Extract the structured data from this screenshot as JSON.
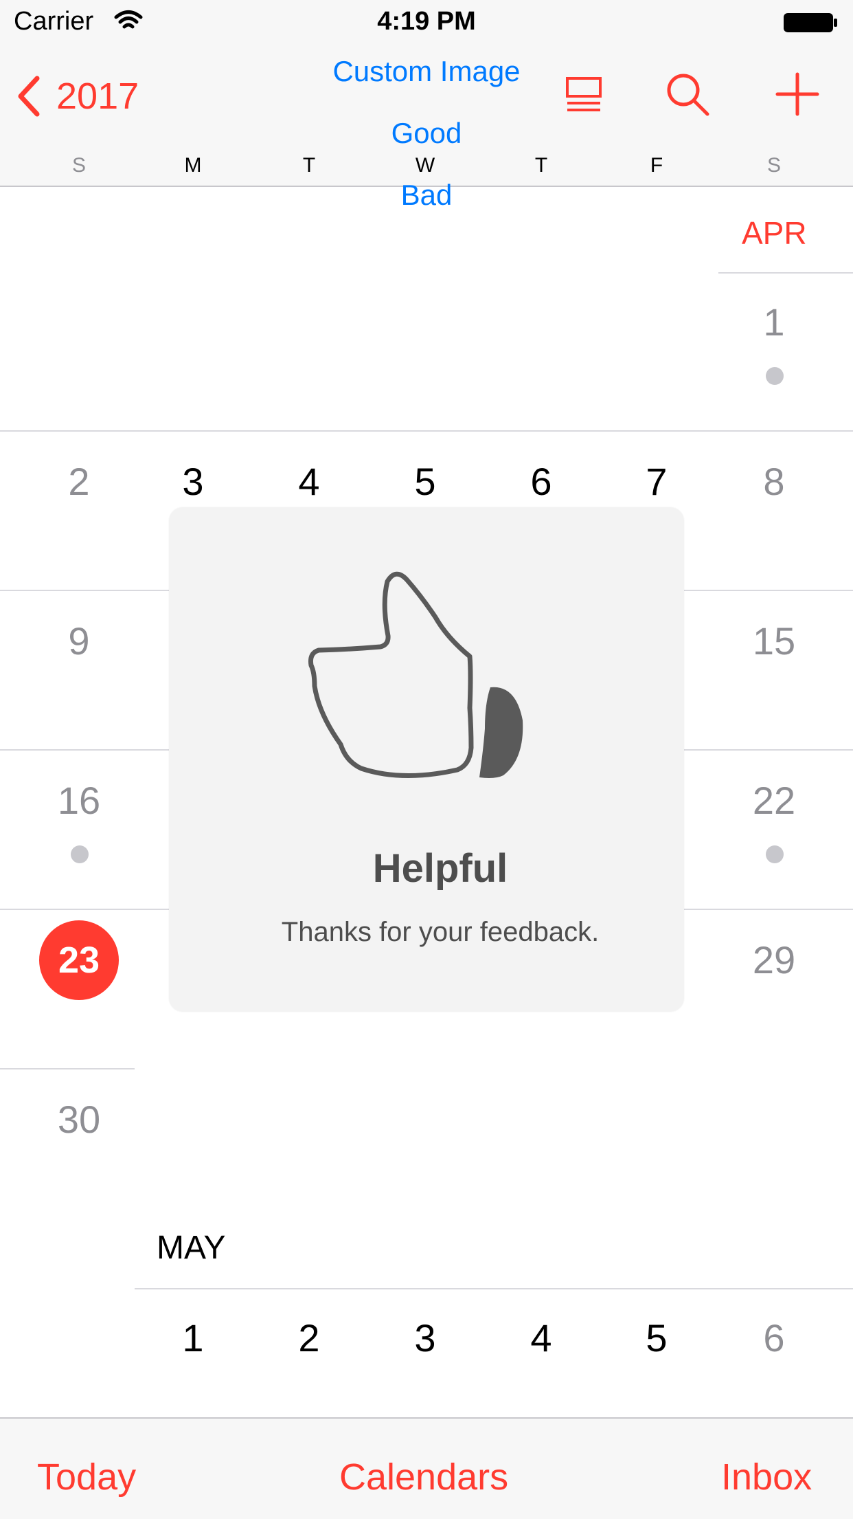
{
  "status_bar": {
    "carrier": "Carrier",
    "time": "4:19 PM"
  },
  "nav": {
    "back_label": "2017",
    "options": [
      "Custom Image",
      "Good",
      "Bad"
    ],
    "weekdays": [
      "S",
      "M",
      "T",
      "W",
      "T",
      "F",
      "S"
    ]
  },
  "calendar": {
    "april_label": "APR",
    "april_days": {
      "d1": "1",
      "d2": "2",
      "d3": "3",
      "d4": "4",
      "d5": "5",
      "d6": "6",
      "d7": "7",
      "d8": "8",
      "d9": "9",
      "d15": "15",
      "d16": "16",
      "d22": "22",
      "d23": "23",
      "d29": "29",
      "d30": "30"
    },
    "may_label": "MAY",
    "may_days": [
      "1",
      "2",
      "3",
      "4",
      "5",
      "6"
    ]
  },
  "hud": {
    "title": "Helpful",
    "message": "Thanks for your feedback."
  },
  "tabbar": {
    "today": "Today",
    "calendars": "Calendars",
    "inbox": "Inbox"
  },
  "colors": {
    "accent": "#ff3b30",
    "link": "#007aff",
    "dot": "#c7c7cc"
  },
  "icons": [
    "wifi-icon",
    "battery-icon",
    "back-chevron-icon",
    "list-view-icon",
    "search-icon",
    "add-icon",
    "thumbs-up-icon"
  ]
}
